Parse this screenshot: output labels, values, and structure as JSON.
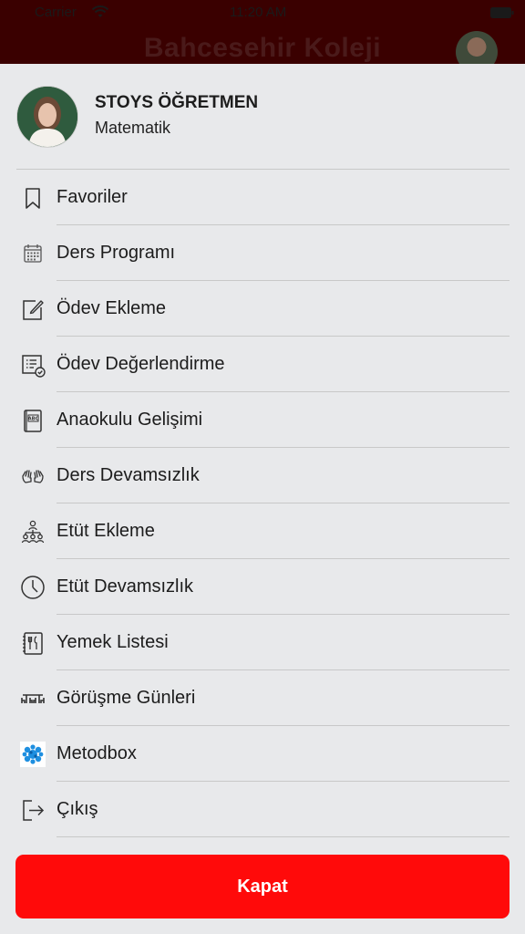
{
  "status_bar": {
    "carrier": "Carrier",
    "time": "11:20 AM"
  },
  "background": {
    "app_title": "Bahcesehir Koleji"
  },
  "profile": {
    "name": "STOYS ÖĞRETMEN",
    "subject": "Matematik"
  },
  "menu": {
    "items": [
      {
        "label": "Favoriler",
        "icon": "bookmark-icon"
      },
      {
        "label": "Ders Programı",
        "icon": "calendar-icon"
      },
      {
        "label": "Ödev Ekleme",
        "icon": "edit-note-icon"
      },
      {
        "label": "Ödev Değerlendirme",
        "icon": "checklist-icon"
      },
      {
        "label": "Anaokulu Gelişimi",
        "icon": "abc-book-icon"
      },
      {
        "label": "Ders Devamsızlık",
        "icon": "raised-hands-icon"
      },
      {
        "label": "Etüt Ekleme",
        "icon": "group-hierarchy-icon"
      },
      {
        "label": "Etüt Devamsızlık",
        "icon": "clock-icon"
      },
      {
        "label": "Yemek Listesi",
        "icon": "menu-book-icon"
      },
      {
        "label": "Görüşme Günleri",
        "icon": "meeting-table-icon"
      },
      {
        "label": "Metodbox",
        "icon": "metodbox-logo-icon"
      },
      {
        "label": "Çıkış",
        "icon": "logout-icon"
      }
    ]
  },
  "close_button": {
    "label": "Kapat"
  },
  "colors": {
    "accent": "#ff0a0a",
    "sheet_background": "#e8e9eb",
    "header_background": "#3a0000"
  }
}
